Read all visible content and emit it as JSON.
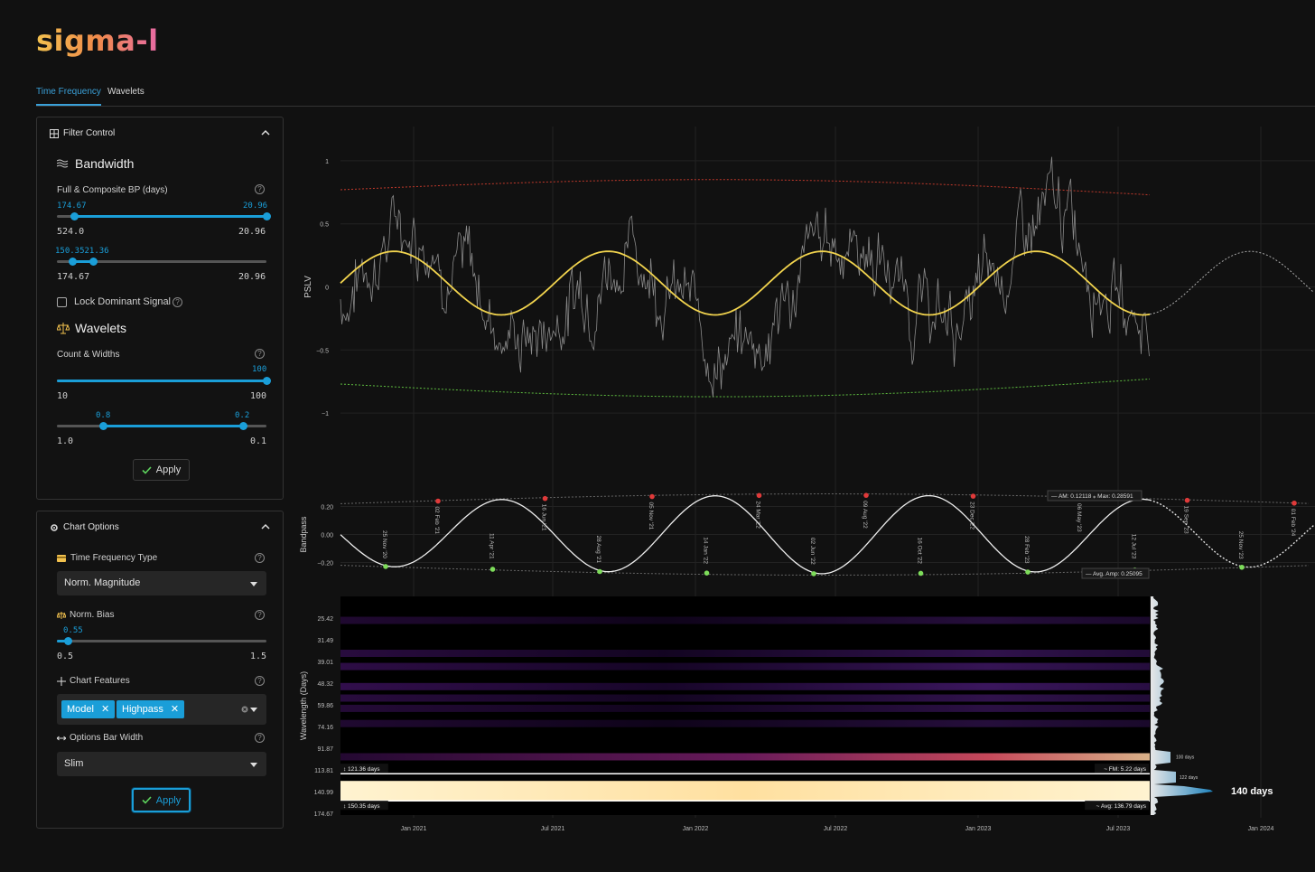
{
  "app": {
    "logo": "sigma-l"
  },
  "tabs": [
    {
      "label": "Time Frequency",
      "active": true
    },
    {
      "label": "Wavelets",
      "active": false
    }
  ],
  "filter_control": {
    "title": "Filter Control",
    "bandwidth": {
      "title": "Bandwidth",
      "label": "Full & Composite BP (days)",
      "slider1": {
        "low_value": "174.67",
        "high_value": "20.96",
        "min_label": "524.0",
        "max_label": "20.96"
      },
      "slider2": {
        "low_value": "150.35",
        "high_value": "121.36",
        "overlap_display": "150.3521.36",
        "min_label": "174.67",
        "max_label": "20.96"
      }
    },
    "lock_dominant_signal": "Lock Dominant Signal",
    "wavelets": {
      "title": "Wavelets",
      "count_label": "Count & Widths",
      "count_slider": {
        "value": "100",
        "min_label": "10",
        "max_label": "100"
      },
      "width_slider": {
        "low_value": "0.8",
        "high_value": "0.2",
        "min_label": "1.0",
        "max_label": "0.1"
      }
    },
    "apply_label": "Apply"
  },
  "chart_options": {
    "title": "Chart Options",
    "tf_type_label": "Time Frequency Type",
    "tf_type_value": "Norm. Magnitude",
    "norm_bias_label": "Norm. Bias",
    "norm_bias": {
      "value": "0.55",
      "min_label": "0.5",
      "max_label": "1.5"
    },
    "chart_features_label": "Chart Features",
    "chart_features": [
      "Model",
      "Highpass"
    ],
    "options_bar_width_label": "Options Bar Width",
    "options_bar_width_value": "Slim",
    "apply_label": "Apply"
  },
  "chart_data": [
    {
      "type": "line",
      "ylabel": "PSLV",
      "yticks": [
        "1",
        "0.5",
        "0",
        "−0.5",
        "−1"
      ],
      "ylim": [
        -1.2,
        1.2
      ],
      "series": [
        {
          "color": "#8a8a8a"
        },
        {
          "color": "#f2d44e"
        },
        {
          "color": "#cccccc"
        }
      ],
      "envelope_colors": {
        "upper": "#c0392b",
        "lower": "#5dbb3f"
      },
      "model_cycle_days": 140,
      "model_amplitude": 0.28
    },
    {
      "type": "line",
      "ylabel": "Bandpass",
      "yticks": [
        "0.20",
        "0.00",
        "−0.20"
      ],
      "ylim": [
        -0.3,
        0.3
      ],
      "peaks": [
        "02 Feb '21",
        "16 Jun '21",
        "05 Nov '21",
        "24 Mar '22",
        "09 Aug '22",
        "23 Dec '22",
        "06 May '23",
        "19 Sep '23",
        "01 Feb '24"
      ],
      "troughs": [
        "25 Nov '20",
        "11 Apr '21",
        "28 Aug '21",
        "14 Jan '22",
        "02 Jun '22",
        "16 Oct '22",
        "28 Feb '23",
        "12 Jul '23",
        "25 Nov '23"
      ],
      "peak_color": "#e03a3a",
      "trough_color": "#7ddc5a",
      "annotations": {
        "am": "AM: 0.12118",
        "max": "Max: 0.28591",
        "avg_amp": "Avg. Amp: 0.25095"
      }
    },
    {
      "type": "heatmap",
      "ylabel": "Wavelength (Days)",
      "yticks": [
        "25.42",
        "31.49",
        "39.01",
        "48.32",
        "59.86",
        "74.16",
        "91.87",
        "113.81",
        "140.99",
        "174.67"
      ],
      "xticks": [
        "Jan 2021",
        "Jul 2021",
        "Jan 2022",
        "Jul 2022",
        "Jan 2023",
        "Jul 2023",
        "Jan 2024"
      ],
      "bands": [
        {
          "days": 26,
          "intensity": 0.35
        },
        {
          "days": 36,
          "intensity": 0.45
        },
        {
          "days": 41,
          "intensity": 0.5
        },
        {
          "days": 50,
          "intensity": 0.55
        },
        {
          "days": 56,
          "intensity": 0.45
        },
        {
          "days": 62,
          "intensity": 0.4
        },
        {
          "days": 72,
          "intensity": 0.35
        },
        {
          "days": 100,
          "intensity": 0.85
        },
        {
          "days": 140,
          "intensity": 1.0
        }
      ],
      "band_labels": {
        "upper": "121.36 days",
        "lower": "150.35 days",
        "fm": "FM: 5.22 days",
        "avg": "Avg: 136.79 days"
      },
      "spectrum_labels": {
        "peak1": "100 days",
        "peak2": "122 days",
        "dominant": "140 days"
      }
    }
  ]
}
